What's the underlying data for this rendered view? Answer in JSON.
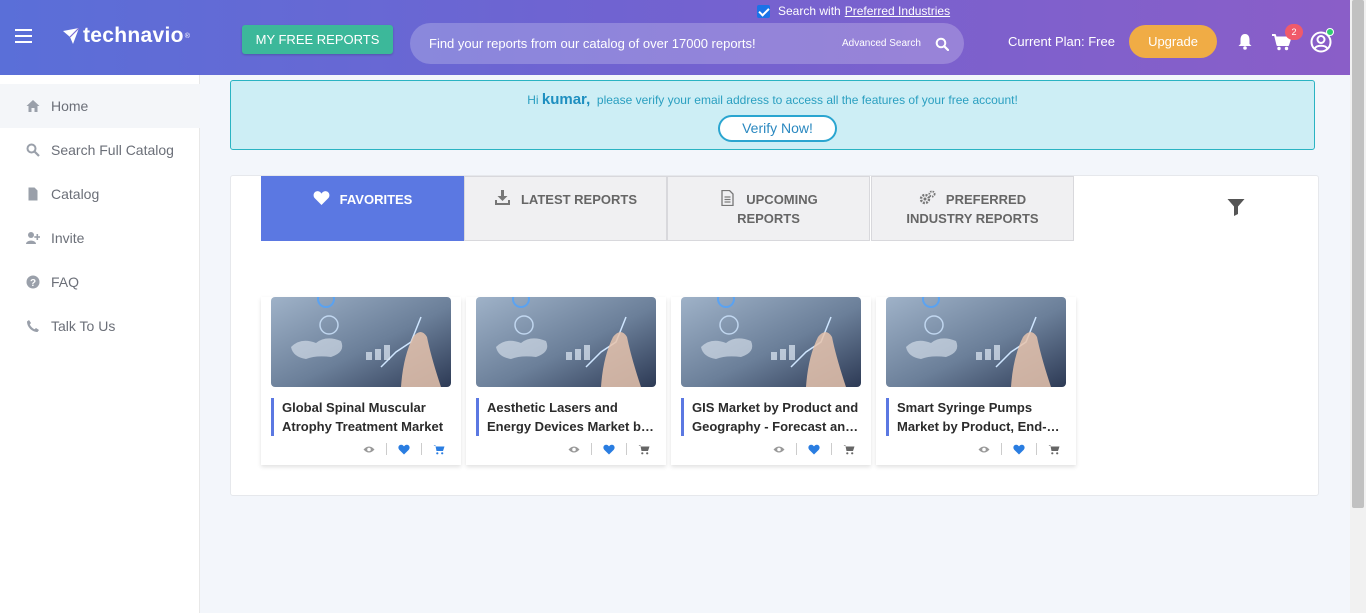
{
  "header": {
    "logo_text": "technavio",
    "logo_tm": "®",
    "free_reports_label": "MY FREE REPORTS",
    "pref_check_prefix": "Search with",
    "pref_check_link": "Preferred Industries",
    "search_placeholder": "Find your reports from our catalog of over 17000 reports!",
    "advanced_search": "Advanced Search",
    "plan_text": "Current Plan: Free",
    "upgrade_label": "Upgrade",
    "cart_count": "2"
  },
  "sidebar": {
    "items": [
      {
        "label": "Home",
        "icon": "home-icon"
      },
      {
        "label": "Search Full Catalog",
        "icon": "search-icon"
      },
      {
        "label": "Catalog",
        "icon": "file-icon"
      },
      {
        "label": "Invite",
        "icon": "user-plus-icon"
      },
      {
        "label": "FAQ",
        "icon": "question-icon"
      },
      {
        "label": "Talk To Us",
        "icon": "phone-icon"
      }
    ]
  },
  "verify": {
    "prefix": "Hi",
    "name": "kumar,",
    "message": "please verify your email address to access all the features of your free account!",
    "button": "Verify Now!"
  },
  "tabs": [
    {
      "line1": "FAVORITES",
      "line2": "",
      "icon": "heart-icon"
    },
    {
      "line1": "LATEST REPORTS",
      "line2": "",
      "icon": "download-icon"
    },
    {
      "line1": "UPCOMING",
      "line2": "REPORTS",
      "icon": "document-icon"
    },
    {
      "line1": "PREFERRED",
      "line2": "INDUSTRY REPORTS",
      "icon": "gears-icon"
    }
  ],
  "cards": [
    {
      "title": "Global Spinal Muscular Atrophy Treatment Market"
    },
    {
      "title": "Aesthetic Lasers and Energy Devices Market by Product"
    },
    {
      "title": "GIS Market by Product and Geography - Forecast and Analysis"
    },
    {
      "title": "Smart Syringe Pumps Market by Product, End-user"
    }
  ],
  "colors": {
    "accent": "#5b78e2",
    "free_reports": "#3cb89a",
    "upgrade": "#f0ac45",
    "badge": "#f05a6a"
  }
}
